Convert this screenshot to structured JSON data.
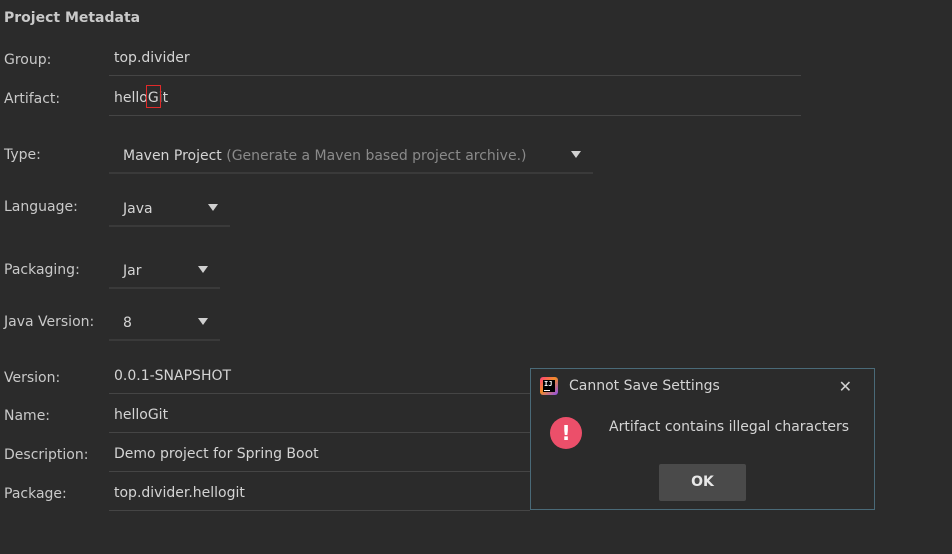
{
  "section": {
    "title": "Project Metadata"
  },
  "fields": {
    "group": {
      "label": "Group:",
      "value": "top.divider"
    },
    "artifact": {
      "label": "Artifact:",
      "value": "helloGit"
    },
    "type": {
      "label": "Type:",
      "value": "Maven Project",
      "hint": "(Generate a Maven based project archive.)"
    },
    "language": {
      "label": "Language:",
      "value": "Java"
    },
    "packaging": {
      "label": "Packaging:",
      "value": "Jar"
    },
    "java_version": {
      "label": "Java Version:",
      "value": "8"
    },
    "version": {
      "label": "Version:",
      "value": "0.0.1-SNAPSHOT"
    },
    "name": {
      "label": "Name:",
      "value": "helloGit"
    },
    "description": {
      "label": "Description:",
      "value": "Demo project for Spring Boot"
    },
    "package": {
      "label": "Package:",
      "value": "top.divider.hellogit"
    }
  },
  "dialog": {
    "title": "Cannot Save Settings",
    "close_icon": "close-icon",
    "app_icon": "intellij-icon",
    "error_icon": "error-icon",
    "message": "Artifact contains illegal characters",
    "ok_label": "OK",
    "border_color": "#4a6a78",
    "error_color": "#ec4f6a"
  },
  "highlight": {
    "color": "#e02a2a"
  }
}
